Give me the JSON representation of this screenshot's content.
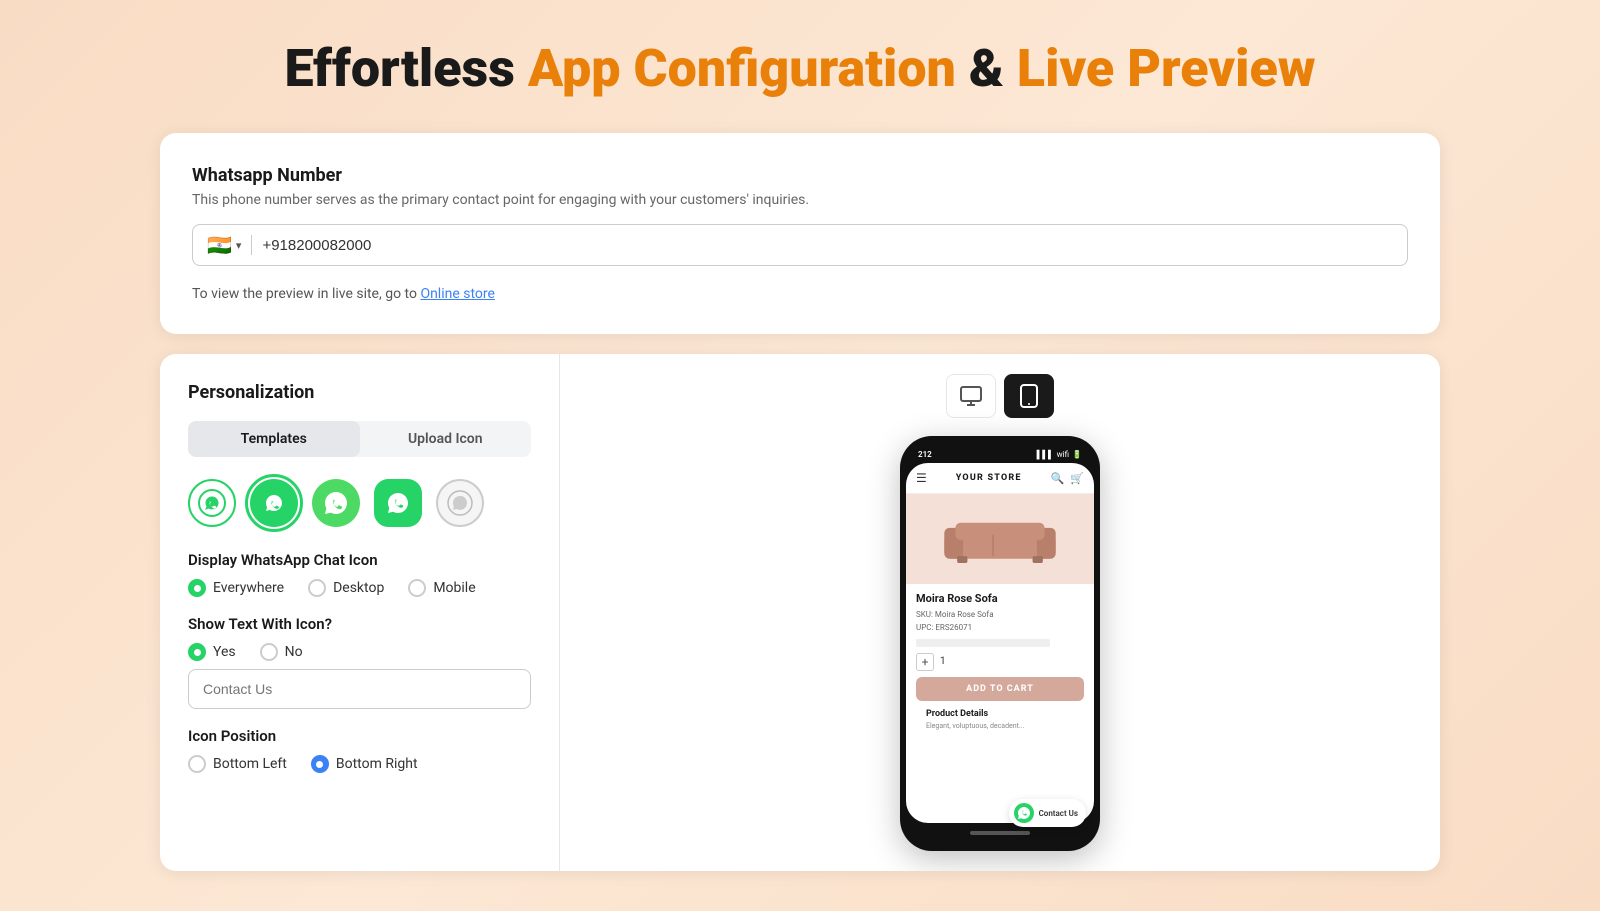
{
  "header": {
    "title_part1": "Effortless",
    "title_part2": "App Configuration",
    "title_part3": "&",
    "title_part4": "Live Preview"
  },
  "whatsapp_section": {
    "label": "Whatsapp Number",
    "description": "This phone number serves as the primary contact point for engaging with your customers' inquiries.",
    "phone_value": "+918200082000",
    "flag_emoji": "🇮🇳",
    "preview_text": "To view the preview in live site, go to",
    "preview_link_text": "Online store",
    "preview_link_href": "#"
  },
  "personalization": {
    "title": "Personalization",
    "tabs": [
      {
        "label": "Templates",
        "active": true
      },
      {
        "label": "Upload Icon",
        "active": false
      }
    ],
    "display_icon_label": "Display WhatsApp Chat Icon",
    "display_options": [
      {
        "label": "Everywhere",
        "checked": true
      },
      {
        "label": "Desktop",
        "checked": false
      },
      {
        "label": "Mobile",
        "checked": false
      }
    ],
    "show_text_label": "Show Text With Icon?",
    "show_text_options": [
      {
        "label": "Yes",
        "checked": true
      },
      {
        "label": "No",
        "checked": false
      }
    ],
    "contact_text_placeholder": "Contact Us",
    "icon_position_label": "Icon Position",
    "icon_position_options": [
      {
        "label": "Bottom Left",
        "checked": false
      },
      {
        "label": "Bottom Right",
        "checked": true
      }
    ]
  },
  "preview": {
    "device_options": [
      "desktop",
      "mobile"
    ],
    "active_device": "mobile",
    "store": {
      "title": "YOUR STORE",
      "product_name": "Moira Rose Sofa",
      "sku": "SKU: Moira Rose Sofa",
      "upc": "UPC: ERS26071",
      "add_to_cart": "ADD TO CART",
      "product_details_title": "Product Details",
      "product_details_text": "Elegant, voluptuous, decadent...",
      "whatsapp_float_text": "Contact Us"
    }
  }
}
